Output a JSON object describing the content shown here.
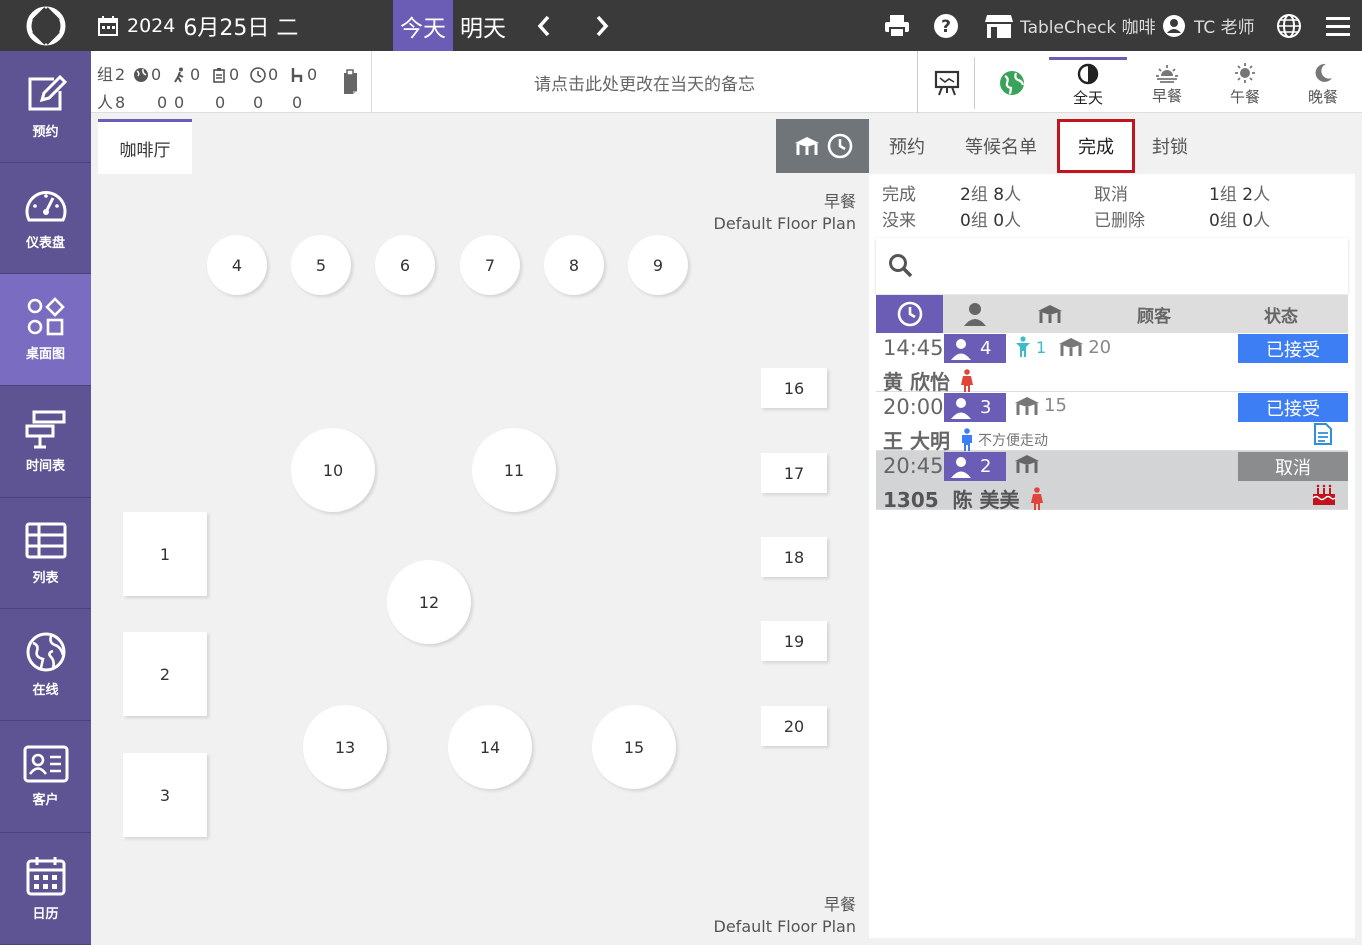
{
  "topbar": {
    "year": "2024",
    "date": "6月25日 二",
    "today_label": "今天",
    "tomorrow_label": "明天",
    "shop_name": "TableCheck 咖啡",
    "user_name": "TC 老师"
  },
  "sidebar": {
    "items": [
      {
        "label": "预约",
        "icon": "edit-icon"
      },
      {
        "label": "仪表盘",
        "icon": "dashboard-icon"
      },
      {
        "label": "桌面图",
        "icon": "floorplan-icon"
      },
      {
        "label": "时间表",
        "icon": "timeline-icon"
      },
      {
        "label": "列表",
        "icon": "list-icon"
      },
      {
        "label": "在线",
        "icon": "globe-icon"
      },
      {
        "label": "客户",
        "icon": "customer-card-icon"
      },
      {
        "label": "日历",
        "icon": "calendar-icon"
      }
    ]
  },
  "stats": {
    "groups_label": "组",
    "people_label": "人",
    "groups": [
      "2",
      "0",
      "0",
      "0",
      "0",
      "0"
    ],
    "people": [
      "8",
      "0",
      "0",
      "0",
      "0",
      "0"
    ]
  },
  "memo_placeholder": "请点击此处更改在当天的备忘",
  "meals": [
    {
      "label": "全天",
      "active": true
    },
    {
      "label": "早餐",
      "active": false
    },
    {
      "label": "午餐",
      "active": false
    },
    {
      "label": "晚餐",
      "active": false
    }
  ],
  "floor": {
    "tab": "咖啡厅",
    "meal_label": "早餐",
    "plan_name": "Default Floor Plan",
    "tables": [
      "1",
      "2",
      "3",
      "4",
      "5",
      "6",
      "7",
      "8",
      "9",
      "10",
      "11",
      "12",
      "13",
      "14",
      "15",
      "16",
      "17",
      "18",
      "19",
      "20"
    ]
  },
  "right_tabs": [
    "预约",
    "等候名单",
    "完成",
    "封锁"
  ],
  "active_tab": "完成",
  "summary": {
    "completed_label": "完成",
    "completed_groups": "2",
    "completed_people": "8",
    "noshow_label": "没来",
    "noshow_groups": "0",
    "noshow_people": "0",
    "cancel_label": "取消",
    "cancel_groups": "1",
    "cancel_people": "2",
    "deleted_label": "已删除",
    "deleted_groups": "0",
    "deleted_people": "0",
    "group_unit": "组",
    "people_unit": "人"
  },
  "table_header": {
    "customer": "顾客",
    "status": "状态"
  },
  "reservations": [
    {
      "time": "14:45",
      "people": "4",
      "kids": "1",
      "table": "20",
      "name": "黄 欣怡",
      "status": "已接受",
      "status_color": "#3d7ef5"
    },
    {
      "time": "20:00",
      "people": "3",
      "table": "15",
      "name": "王 大明",
      "note": "不方便走动",
      "status": "已接受",
      "status_color": "#3d7ef5"
    },
    {
      "time": "20:45",
      "people": "2",
      "table": "",
      "name": "1305  陈 美美",
      "status": "取消",
      "status_color": "#8a8c8e"
    }
  ],
  "colors": {
    "accent": "#6b5cb5",
    "sidebar": "#5f5493",
    "topbar": "#3a3a3a",
    "accepted": "#3d7ef5",
    "highlight": "#c0141e"
  }
}
